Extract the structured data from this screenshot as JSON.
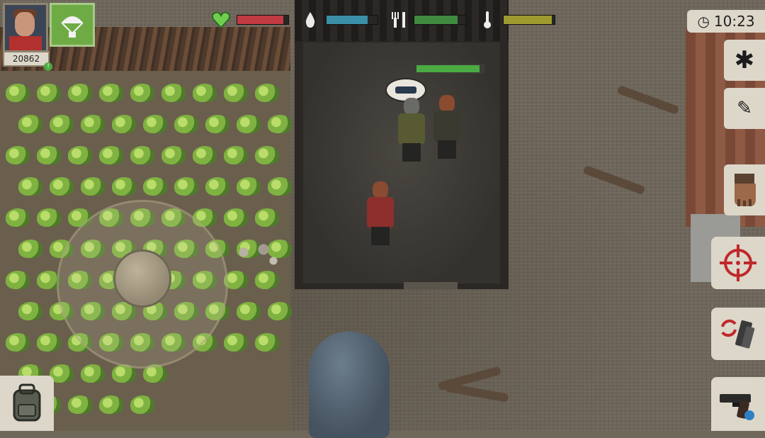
{
  "hud": {
    "score": "20862",
    "clock_time": "10:23",
    "npc_health_fraction": 0.95,
    "stats": [
      {
        "name": "health",
        "icon": "heart-icon",
        "fill_fraction": 0.9,
        "color": "#c23a43"
      },
      {
        "name": "thirst",
        "icon": "water-drop-icon",
        "fill_fraction": 0.8,
        "color": "#3b8fa6"
      },
      {
        "name": "hunger",
        "icon": "fork-knife-icon",
        "fill_fraction": 0.85,
        "color": "#3f8a3f"
      },
      {
        "name": "temperature",
        "icon": "thermometer-icon",
        "fill_fraction": 0.95,
        "color": "#9e9a2f"
      }
    ]
  },
  "controls": {
    "buttons": [
      "settings-gear-icon",
      "quest-notes-icon",
      "interact-hand-icon",
      "crosshair-icon",
      "reload-icon",
      "pistol-icon",
      "backpack-icon",
      "airdrop-parachute-icon"
    ]
  },
  "colors": {
    "panel": "#dcd7c9",
    "health": "#c23a43",
    "npc_health": "#4caa42"
  }
}
